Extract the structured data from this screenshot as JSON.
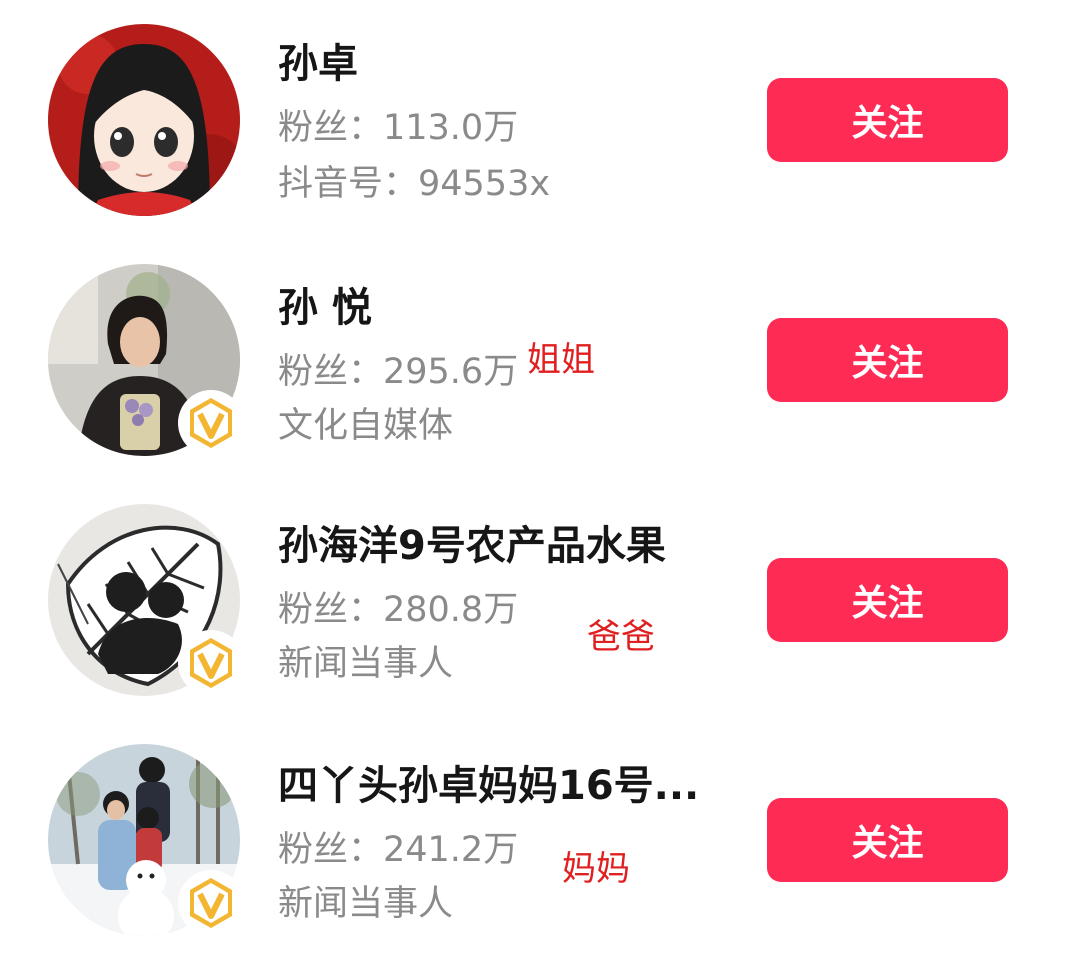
{
  "follow_label": "关注",
  "accounts": [
    {
      "name": "孙卓",
      "fans": "粉丝：113.0万",
      "line2": "抖音号：94553x",
      "verified": false,
      "note": ""
    },
    {
      "name": "孙 悦",
      "fans": "粉丝：295.6万",
      "line2": "文化自媒体",
      "verified": true,
      "note": "姐姐"
    },
    {
      "name": "孙海洋9号农产品水果",
      "fans": "粉丝：280.8万",
      "line2": "新闻当事人",
      "verified": true,
      "note": "爸爸"
    },
    {
      "name": "四丫头孙卓妈妈16号...",
      "fans": "粉丝：241.2万",
      "line2": "新闻当事人",
      "verified": true,
      "note": "妈妈"
    }
  ],
  "colors": {
    "follow_button": "#fe2c55",
    "annotation": "#e02020",
    "verified_badge": "#f2b632"
  },
  "icons": {
    "verified": "verified-v-icon"
  }
}
